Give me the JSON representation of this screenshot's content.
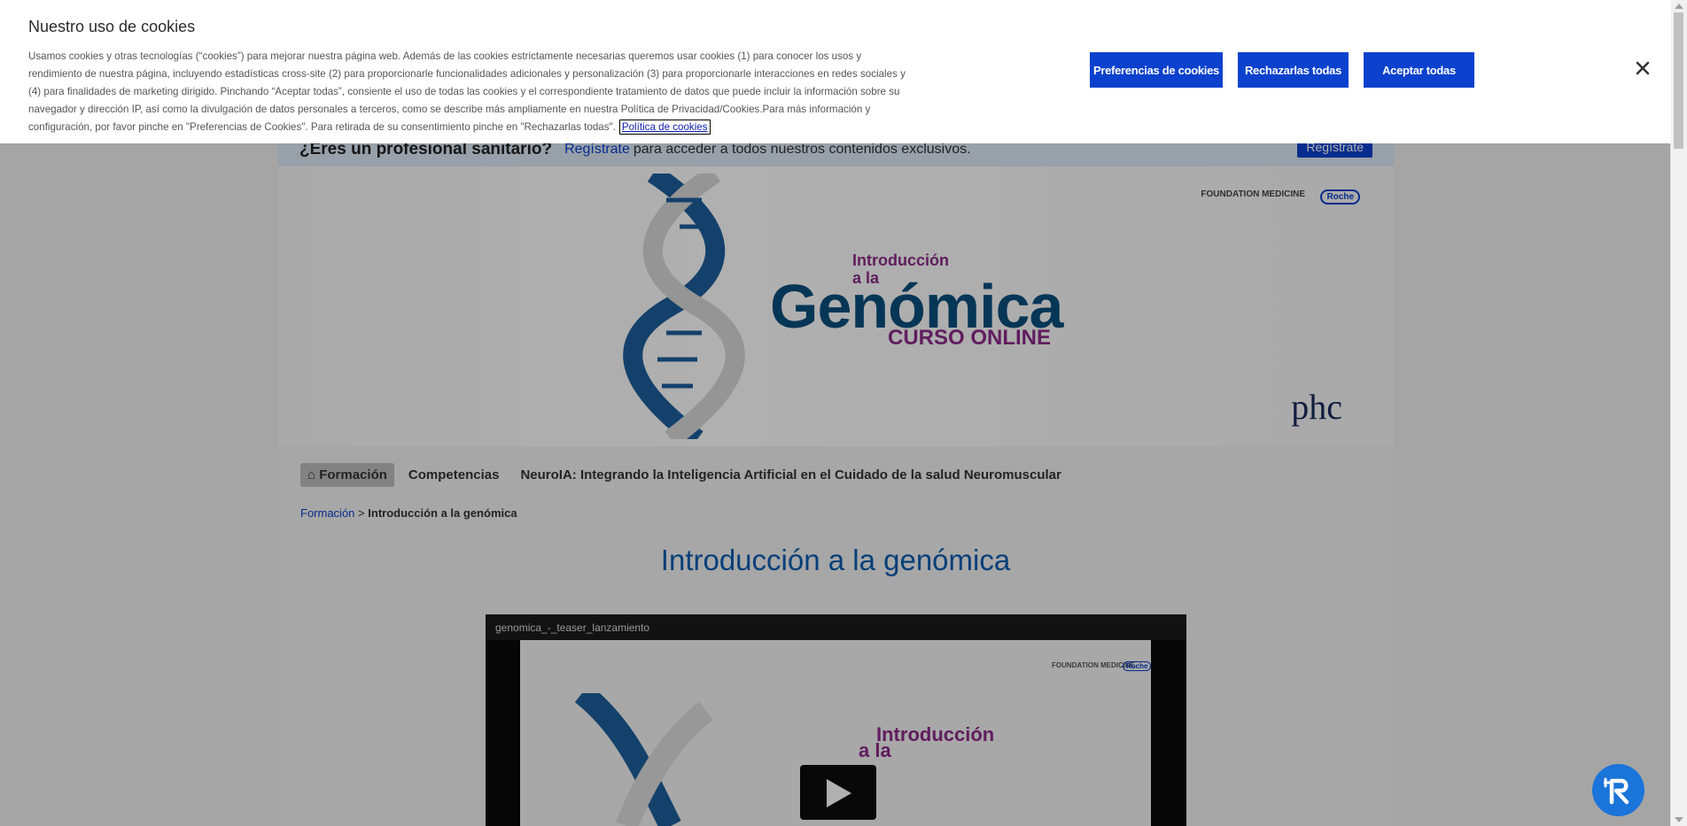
{
  "cookie_banner": {
    "title": "Nuestro uso de cookies",
    "text": "Usamos cookies y otras tecnologías (“cookies”) para mejorar nuestra página web. Además de las cookies estrictamente necesarias queremos usar cookies (1) para conocer los usos y rendimiento de nuestra página, incluyendo estadísticas cross-site (2) para proporcionarle funcionalidades adicionales y personalización (3) para proporcionarle interacciones en redes sociales y (4) para finalidades de marketing dirigido. Pinchando “Aceptar todas”, consiente el uso de todas las cookies y el correspondiente tratamiento de datos que puede incluir la información sobre su navegador y dirección IP, así como la divulgación de datos personales a terceros, como se describe más ampliamente en nuestra Política de Privacidad/Cookies.Para más información y configuración, por favor pinche en \"Preferencias de Cookies\". Para retirada de su consentimiento pinche en \"Rechazarlas todas\".",
    "policy_link": "Política de cookies",
    "btn_preferences": "Preferencias de cookies",
    "btn_reject": "Rechazarlas todas",
    "btn_accept": "Aceptar todas"
  },
  "pro_banner": {
    "question": "¿Eres un profesional sanitario?",
    "link": "Regístrate",
    "rest": "para acceder a todos nuestros contenidos exclusivos.",
    "button": "Regístrate"
  },
  "hero": {
    "line1": "Introducción",
    "line2": "a la",
    "line3": "Genómica",
    "line4": "CURSO ONLINE",
    "partner1": "FOUNDATION MEDICINE",
    "partner2": "Roche",
    "partner3": "phc"
  },
  "nav": {
    "items": [
      {
        "label": "Formación"
      },
      {
        "label": "Competencias"
      },
      {
        "label": "NeuroIA: Integrando la Inteligencia Artificial en el Cuidado de la salud Neuromuscular"
      }
    ]
  },
  "breadcrumb": {
    "link": "Formación",
    "separator": ">",
    "current": "Introducción a la genómica"
  },
  "page_title": "Introducción a la genómica",
  "video": {
    "title": "genomica_-_teaser_lanzamiento",
    "intro": "Introducción",
    "ala": "a la",
    "partner1": "FOUNDATION MEDICINE",
    "partner2": "Roche"
  },
  "colors": {
    "accent": "#0b41cd",
    "title_blue": "#0a5cb0",
    "purple": "#8b2a88",
    "navy": "#0a4f7d"
  }
}
